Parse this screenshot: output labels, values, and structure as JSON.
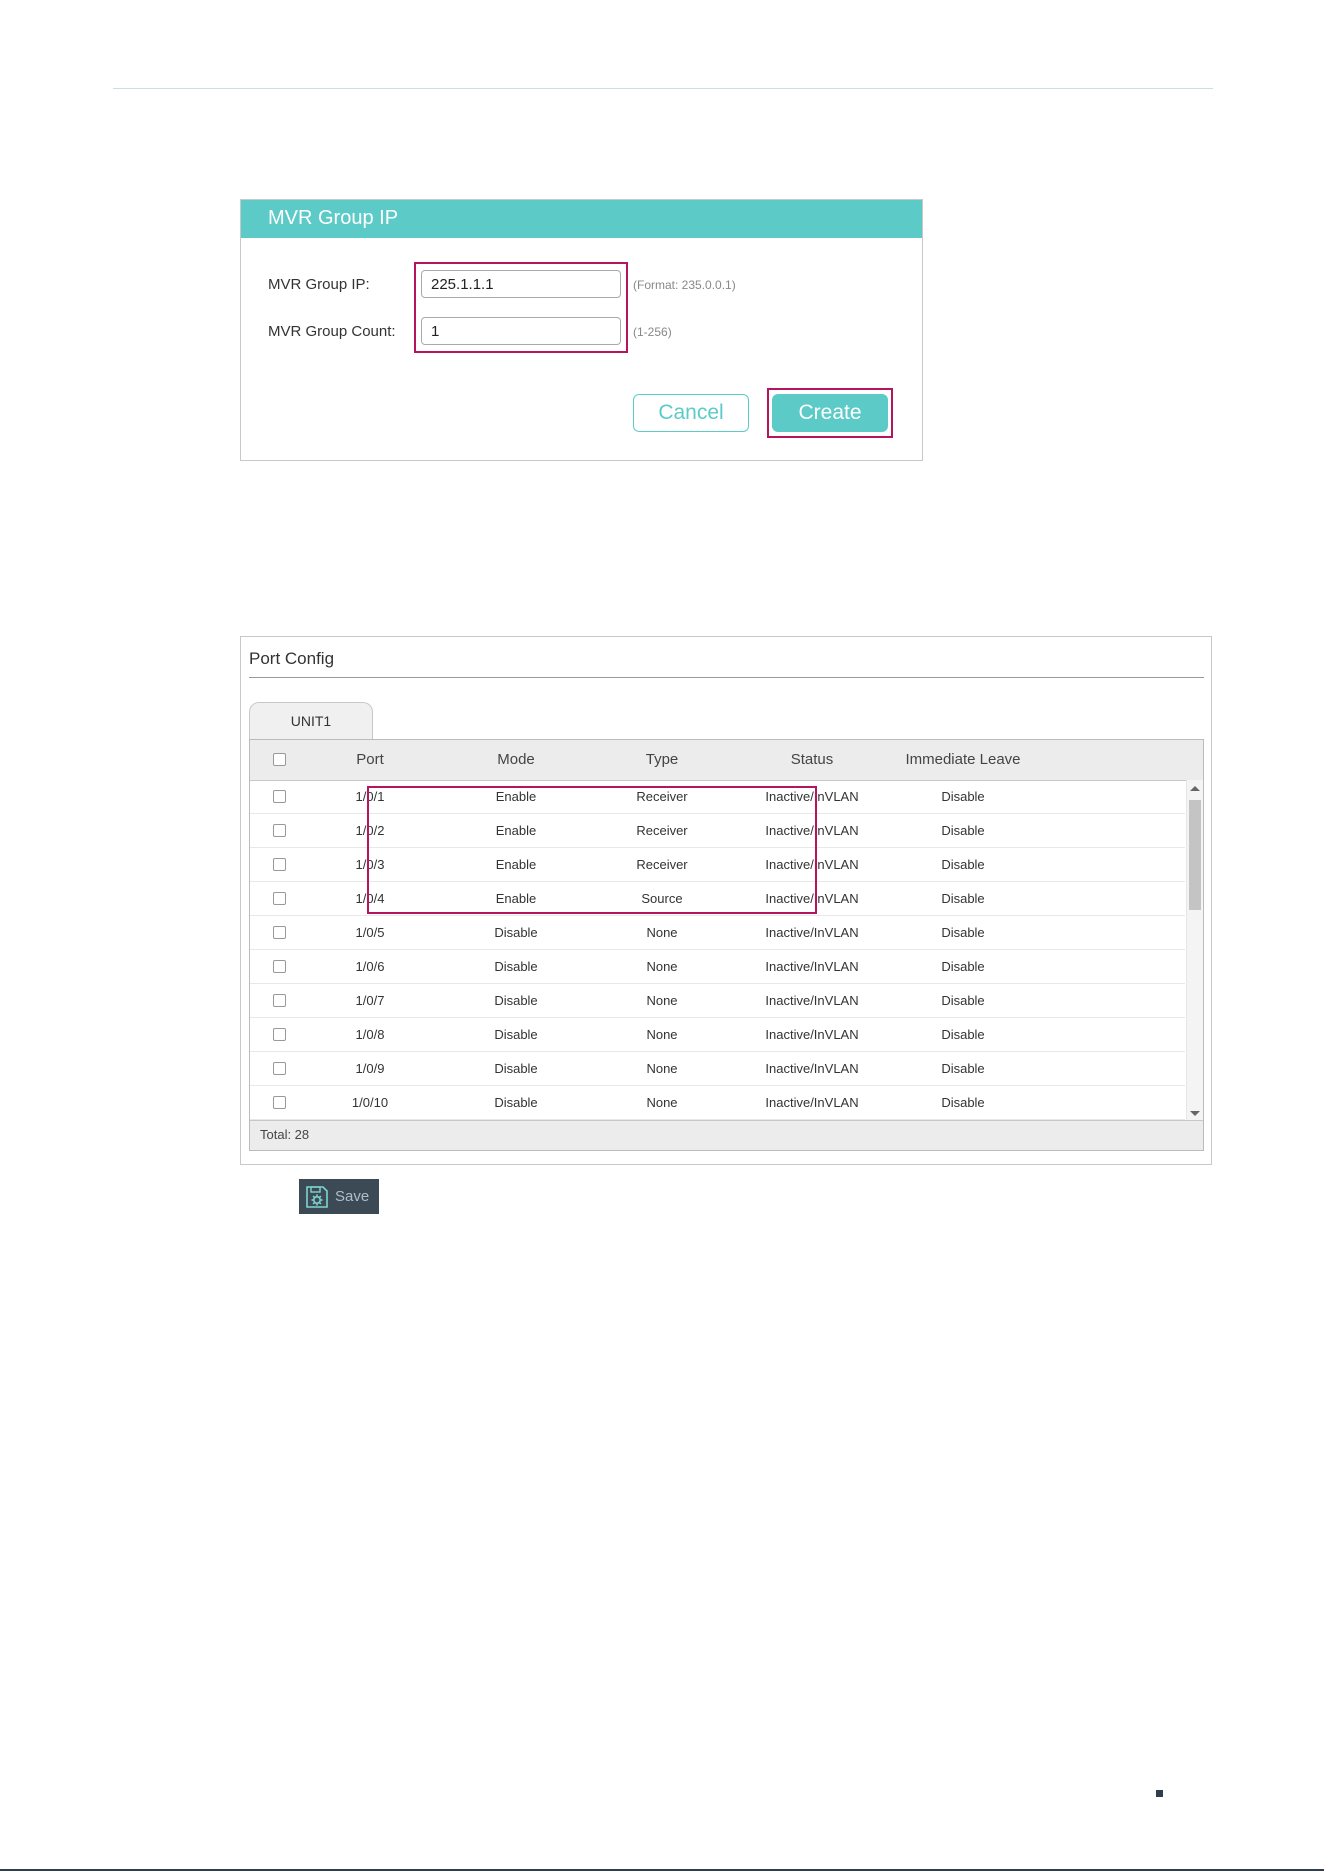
{
  "mvr_panel": {
    "title": "MVR Group IP",
    "group_ip_label": "MVR Group IP:",
    "group_ip_value": "225.1.1.1",
    "group_ip_hint": "(Format: 235.0.0.1)",
    "group_count_label": "MVR Group Count:",
    "group_count_value": "1",
    "group_count_hint": "(1-256)",
    "cancel_label": "Cancel",
    "create_label": "Create",
    "colors": {
      "accent": "#5ccbc8",
      "highlight": "#b5145e"
    }
  },
  "port_config": {
    "title": "Port Config",
    "tab_label": "UNIT1",
    "columns": [
      "Port",
      "Mode",
      "Type",
      "Status",
      "Immediate Leave"
    ],
    "rows": [
      {
        "port": "1/0/1",
        "mode": "Enable",
        "type": "Receiver",
        "status": "Inactive/InVLAN",
        "leave": "Disable"
      },
      {
        "port": "1/0/2",
        "mode": "Enable",
        "type": "Receiver",
        "status": "Inactive/InVLAN",
        "leave": "Disable"
      },
      {
        "port": "1/0/3",
        "mode": "Enable",
        "type": "Receiver",
        "status": "Inactive/InVLAN",
        "leave": "Disable"
      },
      {
        "port": "1/0/4",
        "mode": "Enable",
        "type": "Source",
        "status": "Inactive/InVLAN",
        "leave": "Disable"
      },
      {
        "port": "1/0/5",
        "mode": "Disable",
        "type": "None",
        "status": "Inactive/InVLAN",
        "leave": "Disable"
      },
      {
        "port": "1/0/6",
        "mode": "Disable",
        "type": "None",
        "status": "Inactive/InVLAN",
        "leave": "Disable"
      },
      {
        "port": "1/0/7",
        "mode": "Disable",
        "type": "None",
        "status": "Inactive/InVLAN",
        "leave": "Disable"
      },
      {
        "port": "1/0/8",
        "mode": "Disable",
        "type": "None",
        "status": "Inactive/InVLAN",
        "leave": "Disable"
      },
      {
        "port": "1/0/9",
        "mode": "Disable",
        "type": "None",
        "status": "Inactive/InVLAN",
        "leave": "Disable"
      },
      {
        "port": "1/0/10",
        "mode": "Disable",
        "type": "None",
        "status": "Inactive/InVLAN",
        "leave": "Disable"
      }
    ],
    "total": "Total: 28"
  },
  "save_button": {
    "label": "Save",
    "icon": "save-gear-icon"
  }
}
